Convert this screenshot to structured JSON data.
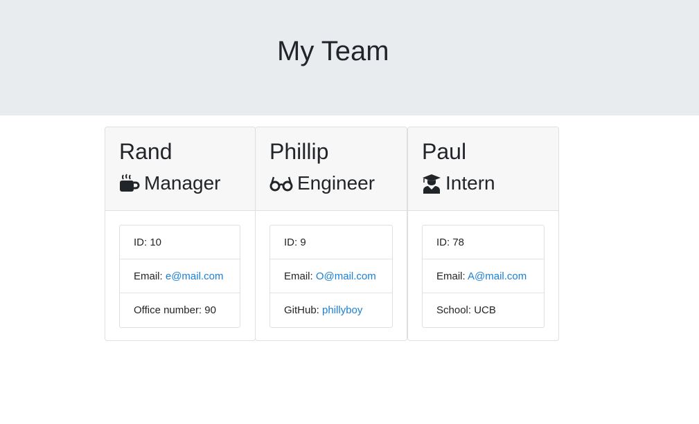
{
  "header": {
    "title": "My Team"
  },
  "employees": [
    {
      "name": "Rand",
      "role": "Manager",
      "role_icon": "mug-icon",
      "id_label": "ID: 10",
      "email_label": "Email:",
      "email": "e@mail.com",
      "extra_label": "Office number: 90",
      "extra_link": ""
    },
    {
      "name": "Phillip",
      "role": "Engineer",
      "role_icon": "glasses-icon",
      "id_label": "ID: 9",
      "email_label": "Email:",
      "email": "O@mail.com",
      "extra_label": "GitHub:",
      "extra_link": "phillyboy"
    },
    {
      "name": "Paul",
      "role": "Intern",
      "role_icon": "graduate-icon",
      "id_label": "ID: 78",
      "email_label": "Email:",
      "email": "A@mail.com",
      "extra_label": "School: UCB",
      "extra_link": ""
    }
  ],
  "colors": {
    "header_bg": "#e9ecef",
    "card_header_bg": "#f7f7f7",
    "link": "#1a7fd6",
    "text": "#212529"
  }
}
